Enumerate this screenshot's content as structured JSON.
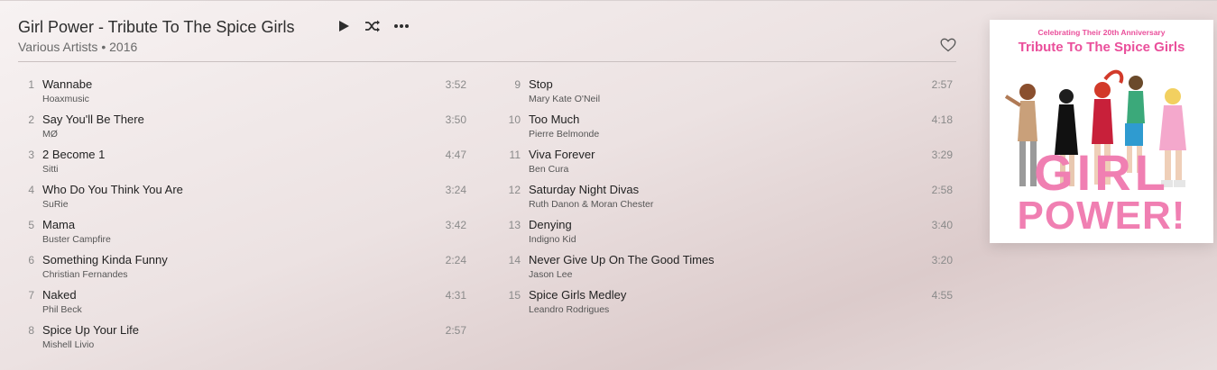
{
  "album": {
    "title": "Girl Power - Tribute To The Spice Girls",
    "subtitle": "Various Artists • 2016"
  },
  "controls": {
    "play_icon": "play-icon",
    "shuffle_icon": "shuffle-icon",
    "more_icon": "more-icon",
    "favorite_icon": "heart-icon"
  },
  "tracks_left": [
    {
      "num": "1",
      "name": "Wannabe",
      "artist": "Hoaxmusic",
      "duration": "3:52"
    },
    {
      "num": "2",
      "name": "Say You'll Be There",
      "artist": "MØ",
      "duration": "3:50"
    },
    {
      "num": "3",
      "name": "2 Become 1",
      "artist": "Sitti",
      "duration": "4:47"
    },
    {
      "num": "4",
      "name": "Who Do You Think You Are",
      "artist": "SuRie",
      "duration": "3:24"
    },
    {
      "num": "5",
      "name": "Mama",
      "artist": "Buster Campfire",
      "duration": "3:42"
    },
    {
      "num": "6",
      "name": "Something Kinda Funny",
      "artist": "Christian Fernandes",
      "duration": "2:24"
    },
    {
      "num": "7",
      "name": "Naked",
      "artist": "Phil Beck",
      "duration": "4:31"
    },
    {
      "num": "8",
      "name": "Spice Up Your Life",
      "artist": "Mishell Livio",
      "duration": "2:57"
    }
  ],
  "tracks_right": [
    {
      "num": "9",
      "name": "Stop",
      "artist": "Mary Kate O'Neil",
      "duration": "2:57"
    },
    {
      "num": "10",
      "name": "Too Much",
      "artist": "Pierre Belmonde",
      "duration": "4:18"
    },
    {
      "num": "11",
      "name": "Viva Forever",
      "artist": "Ben Cura",
      "duration": "3:29"
    },
    {
      "num": "12",
      "name": "Saturday Night Divas",
      "artist": "Ruth Danon & Moran Chester",
      "duration": "2:58"
    },
    {
      "num": "13",
      "name": "Denying",
      "artist": "Indigno Kid",
      "duration": "3:40"
    },
    {
      "num": "14",
      "name": "Never Give Up On The Good Times",
      "artist": "Jason Lee",
      "duration": "3:20"
    },
    {
      "num": "15",
      "name": "Spice Girls Medley",
      "artist": "Leandro Rodrigues",
      "duration": "4:55"
    }
  ],
  "cover": {
    "subtitle": "Celebrating Their 20th Anniversary",
    "title": "Tribute To The Spice Girls",
    "word1": "GIRL",
    "word2": "POWER!",
    "accent_color": "#ea4f9b"
  }
}
